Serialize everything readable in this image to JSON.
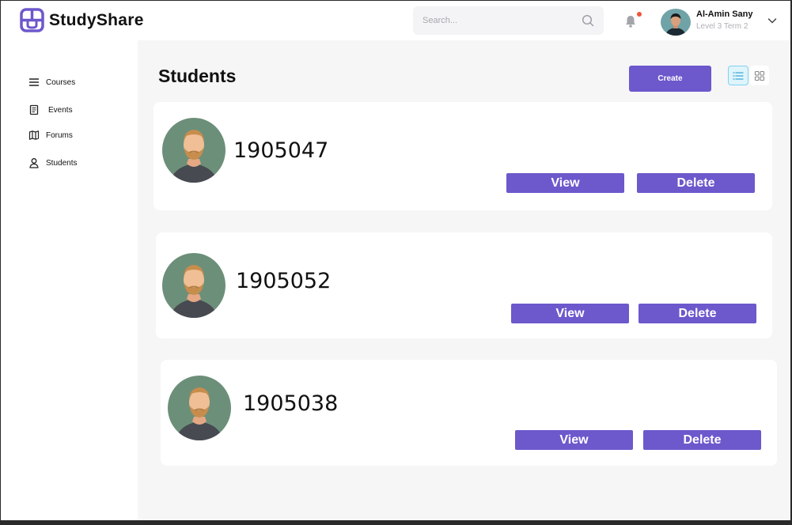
{
  "app": {
    "name": "StudyShare"
  },
  "search": {
    "placeholder": "Search..."
  },
  "user": {
    "name": "Al-Amin Sany",
    "level": "Level 3 Term 2"
  },
  "sidebar": {
    "items": [
      {
        "label": "Courses",
        "icon": "menu-icon"
      },
      {
        "label": "Events",
        "icon": "document-icon"
      },
      {
        "label": "Forums",
        "icon": "map-icon"
      },
      {
        "label": "Students",
        "icon": "user-icon"
      }
    ]
  },
  "main": {
    "title": "Students",
    "create_label": "Create",
    "students": [
      {
        "id": "1905047",
        "view_label": "View",
        "delete_label": "Delete"
      },
      {
        "id": "1905052",
        "view_label": "View",
        "delete_label": "Delete"
      },
      {
        "id": "1905038",
        "view_label": "View",
        "delete_label": "Delete"
      }
    ]
  },
  "colors": {
    "accent": "#6d58cc",
    "background": "#f6f6f7",
    "notification": "#f0543a"
  }
}
